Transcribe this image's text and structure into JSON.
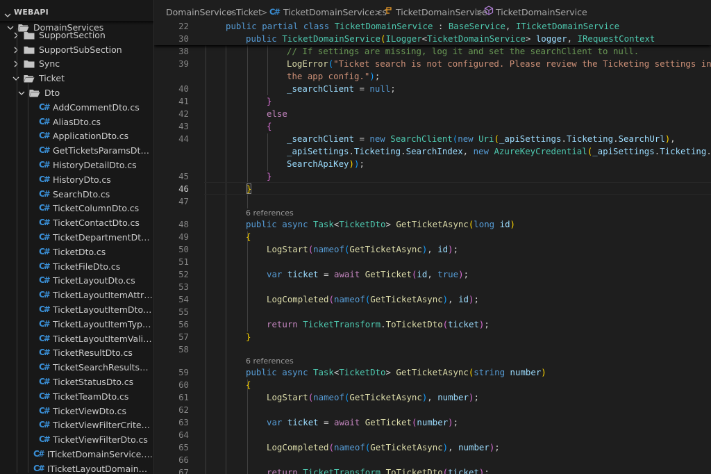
{
  "explorer": {
    "section_title": "WEBAPI",
    "items": [
      {
        "label": "DomainServices",
        "kind": "folder-open"
      },
      {
        "label": "SupportSection",
        "kind": "folder"
      },
      {
        "label": "SupportSubSection",
        "kind": "folder"
      },
      {
        "label": "Sync",
        "kind": "folder"
      },
      {
        "label": "Ticket",
        "kind": "folder-open"
      },
      {
        "label": "Dto",
        "kind": "folder-open"
      },
      {
        "label": "AddCommentDto.cs",
        "kind": "cs-file"
      },
      {
        "label": "AliasDto.cs",
        "kind": "cs-file"
      },
      {
        "label": "ApplicationDto.cs",
        "kind": "cs-file"
      },
      {
        "label": "GetTicketsParamsDto.cs",
        "kind": "cs-file"
      },
      {
        "label": "HistoryDetailDto.cs",
        "kind": "cs-file"
      },
      {
        "label": "HistoryDto.cs",
        "kind": "cs-file"
      },
      {
        "label": "SearchDto.cs",
        "kind": "cs-file"
      },
      {
        "label": "TicketColumnDto.cs",
        "kind": "cs-file"
      },
      {
        "label": "TicketContactDto.cs",
        "kind": "cs-file"
      },
      {
        "label": "TicketDepartmentDto.cs",
        "kind": "cs-file"
      },
      {
        "label": "TicketDto.cs",
        "kind": "cs-file"
      },
      {
        "label": "TicketFileDto.cs",
        "kind": "cs-file"
      },
      {
        "label": "TicketLayoutDto.cs",
        "kind": "cs-file"
      },
      {
        "label": "TicketLayoutItemAttribut...",
        "kind": "cs-file"
      },
      {
        "label": "TicketLayoutItemDto.cs",
        "kind": "cs-file"
      },
      {
        "label": "TicketLayoutItemTypeDt...",
        "kind": "cs-file"
      },
      {
        "label": "TicketLayoutItemValidVal...",
        "kind": "cs-file"
      },
      {
        "label": "TicketResultDto.cs",
        "kind": "cs-file"
      },
      {
        "label": "TicketSearchResultsDto.cs",
        "kind": "cs-file"
      },
      {
        "label": "TicketStatusDto.cs",
        "kind": "cs-file"
      },
      {
        "label": "TicketTeamDto.cs",
        "kind": "cs-file"
      },
      {
        "label": "TicketViewDto.cs",
        "kind": "cs-file"
      },
      {
        "label": "TicketViewFilterCriteriaDt...",
        "kind": "cs-file"
      },
      {
        "label": "TicketViewFilterDto.cs",
        "kind": "cs-file"
      },
      {
        "label": "ITicketDomainService.cs",
        "kind": "cs-file"
      },
      {
        "label": "ITicketLayoutDomainServi...",
        "kind": "cs-file"
      }
    ],
    "cs_badge": "C#"
  },
  "breadcrumb": {
    "folder1": "DomainServices",
    "folder2": "Ticket",
    "file": "TicketDomainService.cs",
    "class": "TicketDomainService",
    "member": "TicketDomainService",
    "separator": ">"
  },
  "editor": {
    "current_line": "46",
    "references_label": "6 references",
    "lines": [
      {
        "n": "22"
      },
      {
        "n": "30"
      },
      {
        "n": "38"
      },
      {
        "n": "39"
      },
      {
        "n": "40"
      },
      {
        "n": "41"
      },
      {
        "n": "42"
      },
      {
        "n": "43"
      },
      {
        "n": "44"
      },
      {
        "n": "45"
      },
      {
        "n": "46"
      },
      {
        "n": "47"
      },
      {
        "n": "48"
      },
      {
        "n": "49"
      },
      {
        "n": "50"
      },
      {
        "n": "51"
      },
      {
        "n": "52"
      },
      {
        "n": "53"
      },
      {
        "n": "54"
      },
      {
        "n": "55"
      },
      {
        "n": "56"
      },
      {
        "n": "57"
      },
      {
        "n": "58"
      },
      {
        "n": "59"
      },
      {
        "n": "60"
      },
      {
        "n": "61"
      },
      {
        "n": "62"
      },
      {
        "n": "63"
      },
      {
        "n": "64"
      },
      {
        "n": "65"
      },
      {
        "n": "66"
      },
      {
        "n": "67"
      }
    ],
    "code": {
      "l22": "public partial class TicketDomainService : BaseService, ITicketDomainService",
      "l30": "public TicketDomainService(ILogger<TicketDomainService> logger, IRequestContext",
      "l38": "// If settings are missing, log it and set the searchClient to null.",
      "l39a": "LogError(\"Ticket search is not configured. Please review the Ticketing settings in",
      "l39b": "the app config.\");",
      "l40": "_searchClient = null;",
      "l41": "}",
      "l42": "else",
      "l43": "{",
      "l44a": "_searchClient = new SearchClient(new Uri(_apiSettings.Ticketing.SearchUrl),",
      "l44b": "_apiSettings.Ticketing.SearchIndex, new AzureKeyCredential(_apiSettings.Ticketing.",
      "l44c": "SearchApiKey));",
      "l45": "}",
      "l46": "}",
      "l48": "public async Task<TicketDto> GetTicketAsync(long id)",
      "l49": "{",
      "l50": "LogStart(nameof(GetTicketAsync), id);",
      "l52": "var ticket = await GetTicket(id, true);",
      "l54": "LogCompleted(nameof(GetTicketAsync), id);",
      "l56": "return TicketTransform.ToTicketDto(ticket);",
      "l57": "}",
      "l59": "public async Task<TicketDto> GetTicketAsync(string number)",
      "l60": "{",
      "l61": "LogStart(nameof(GetTicketAsync), number);",
      "l63": "var ticket = await GetTicket(number);",
      "l65": "LogCompleted(nameof(GetTicketAsync), number);",
      "l67": "return TicketTransform.ToTicketDto(ticket);"
    }
  }
}
